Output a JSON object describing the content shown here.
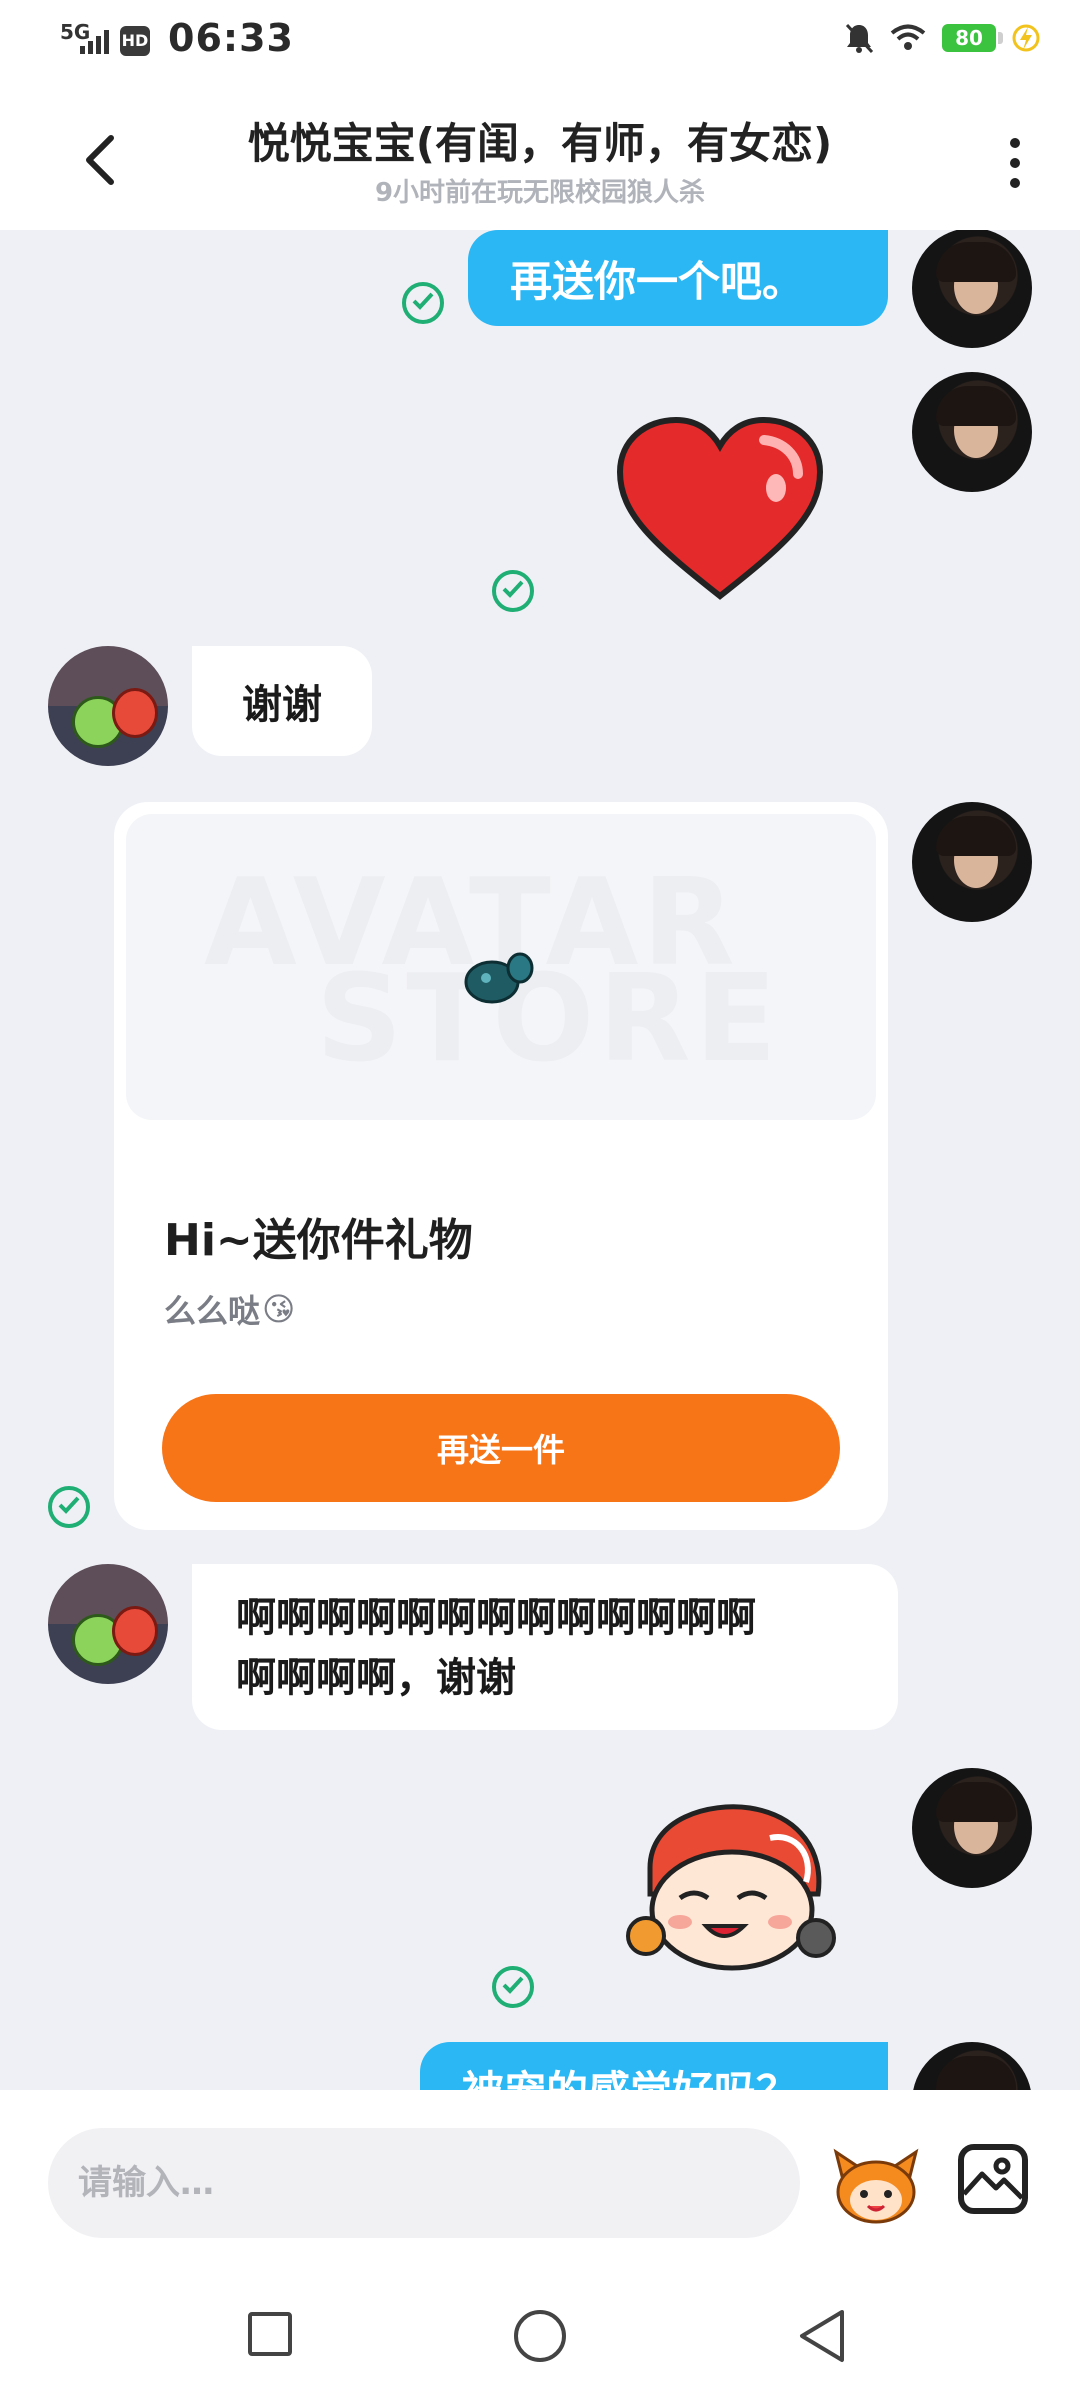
{
  "status_bar": {
    "network": "5G",
    "hd": "HD",
    "time": "06:33",
    "battery": "80",
    "icons": [
      "signal-icon",
      "hd-icon",
      "mute-icon",
      "wifi-icon",
      "battery-icon",
      "charging-icon"
    ]
  },
  "header": {
    "title": "悦悦宝宝(有闺，有师，有女恋)",
    "subtitle": "9小时前在玩无限校园狼人杀",
    "back_icon": "chevron-left-icon",
    "more_icon": "more-vertical-icon"
  },
  "messages": [
    {
      "side": "self",
      "type": "text",
      "text": "再送你一个吧。",
      "status": "sent"
    },
    {
      "side": "self",
      "type": "sticker",
      "sticker": "red-heart",
      "status": "sent"
    },
    {
      "side": "other",
      "type": "text",
      "text": "谢谢"
    },
    {
      "side": "self",
      "type": "gift",
      "banner_watermark_1": "AVATAR",
      "banner_watermark_2": "STORE",
      "title": "Hi~送你件礼物",
      "subtitle": "么么哒",
      "emoji": "😘",
      "button": "再送一件",
      "status": "sent"
    },
    {
      "side": "other",
      "type": "text",
      "line1": "啊啊啊啊啊啊啊啊啊啊啊啊啊",
      "line2": "啊啊啊啊，谢谢"
    },
    {
      "side": "self",
      "type": "sticker",
      "sticker": "mascot-face",
      "status": "sent"
    },
    {
      "side": "self",
      "type": "text",
      "text": "被宠的感觉好吗？",
      "partially_visible": true
    }
  ],
  "input_bar": {
    "placeholder": "请输入…"
  },
  "colors": {
    "self_bubble": "#2bb7f4",
    "gift_button": "#f77417",
    "sent_check": "#1fae74",
    "chat_bg": "#eef0f5"
  }
}
